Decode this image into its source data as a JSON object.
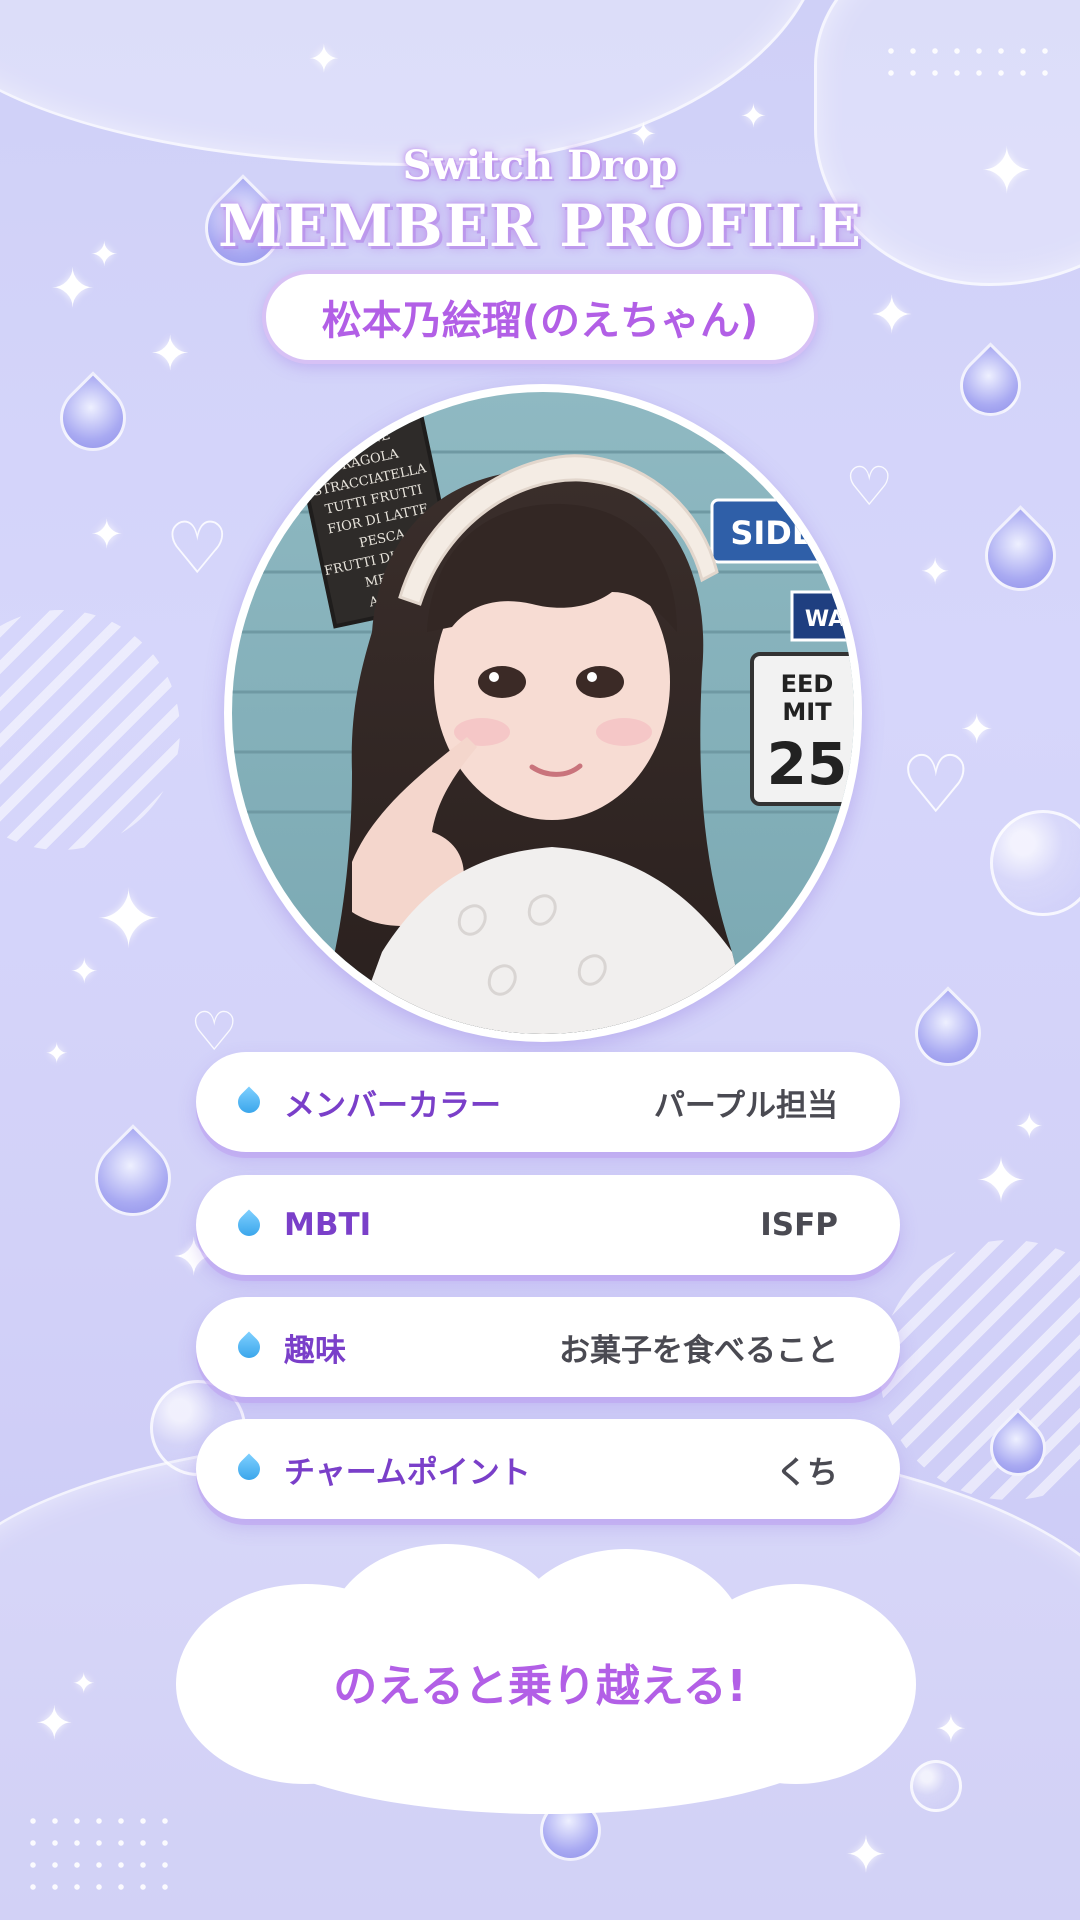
{
  "header": {
    "brand": "Switch Drop",
    "title": "MEMBER PROFILE"
  },
  "member": {
    "name": "松本乃絵瑠(のえちゃん)"
  },
  "profile_rows": [
    {
      "label": "メンバーカラー",
      "value": "パープル担当"
    },
    {
      "label": "MBTI",
      "value": "ISFP"
    },
    {
      "label": "趣味",
      "value": "お菓子を食べること"
    },
    {
      "label": "チャームポイント",
      "value": "くち"
    }
  ],
  "catchphrase": "のえると乗り越える!",
  "photo_sign_text": [
    "LIMONE",
    "FRAGOLA",
    "STRACCIATELLA",
    "TUTTI FRUTTI",
    "FIOR DI LATTE",
    "PESCA",
    "FRUTTI DI BOSCO",
    "MENTA",
    "AMARE"
  ],
  "photo_plate_text": [
    "SIDE",
    "WAY",
    "EED",
    "MIT",
    "25"
  ],
  "colors": {
    "accent_purple": "#b25fe6",
    "label_purple": "#7a3fc9",
    "value_gray": "#4a4a52",
    "background_lavender": "#d6d6fb",
    "drop_blue": "#2f9fe8"
  },
  "icons": {
    "row_bullet": "water-drop-icon",
    "decoration": [
      "sparkle-icon",
      "heart-icon",
      "water-drop-icon",
      "bubble-icon"
    ]
  }
}
